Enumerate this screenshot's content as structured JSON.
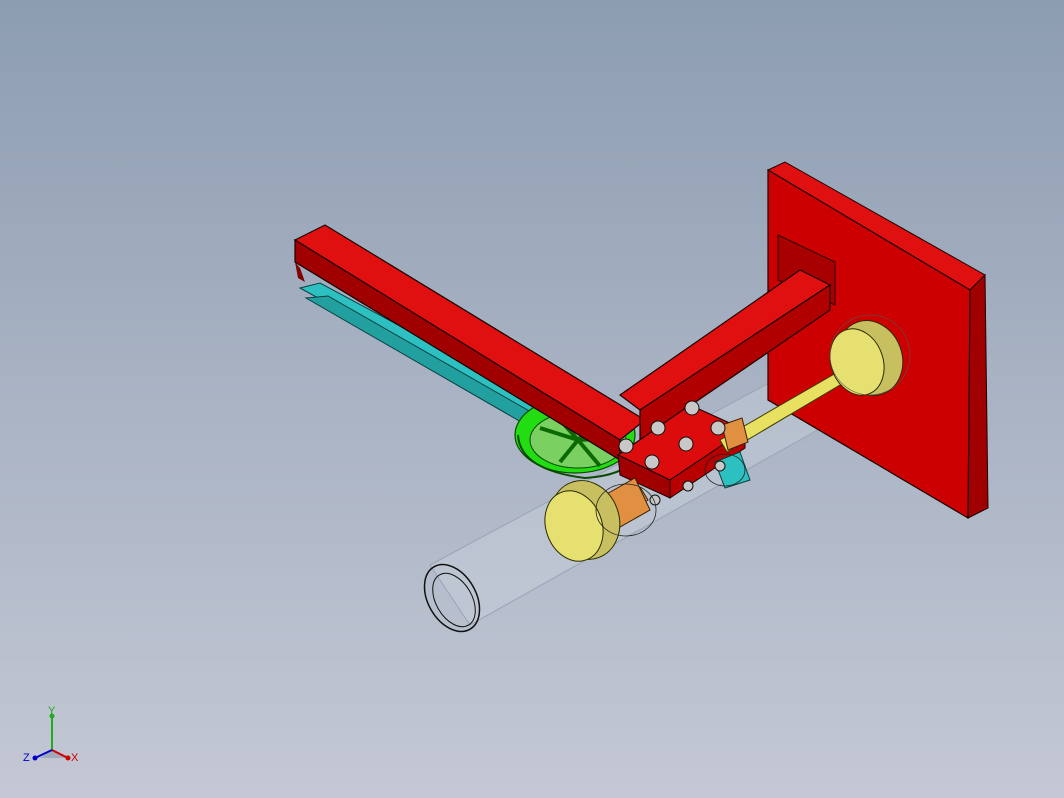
{
  "viewport": {
    "background_top": "#8d9db1",
    "background_bottom": "#c4c8d4"
  },
  "model": {
    "frame_color": "#cc0000",
    "frame_edge_color": "#1a0000",
    "wheel_color": "#22dd11",
    "roller_color": "#e6e070",
    "shaft_color": "#e8e060",
    "link_color": "#2cc0c0",
    "bushing_color": "#e09040",
    "bolt_color": "#c8c8c8",
    "pipe_outline_color": "#111111"
  },
  "triad": {
    "x_label": "X",
    "y_label": "Y",
    "z_label": "Z",
    "x_color": "#cc0000",
    "y_color": "#22aa22",
    "z_color": "#0000cc"
  }
}
